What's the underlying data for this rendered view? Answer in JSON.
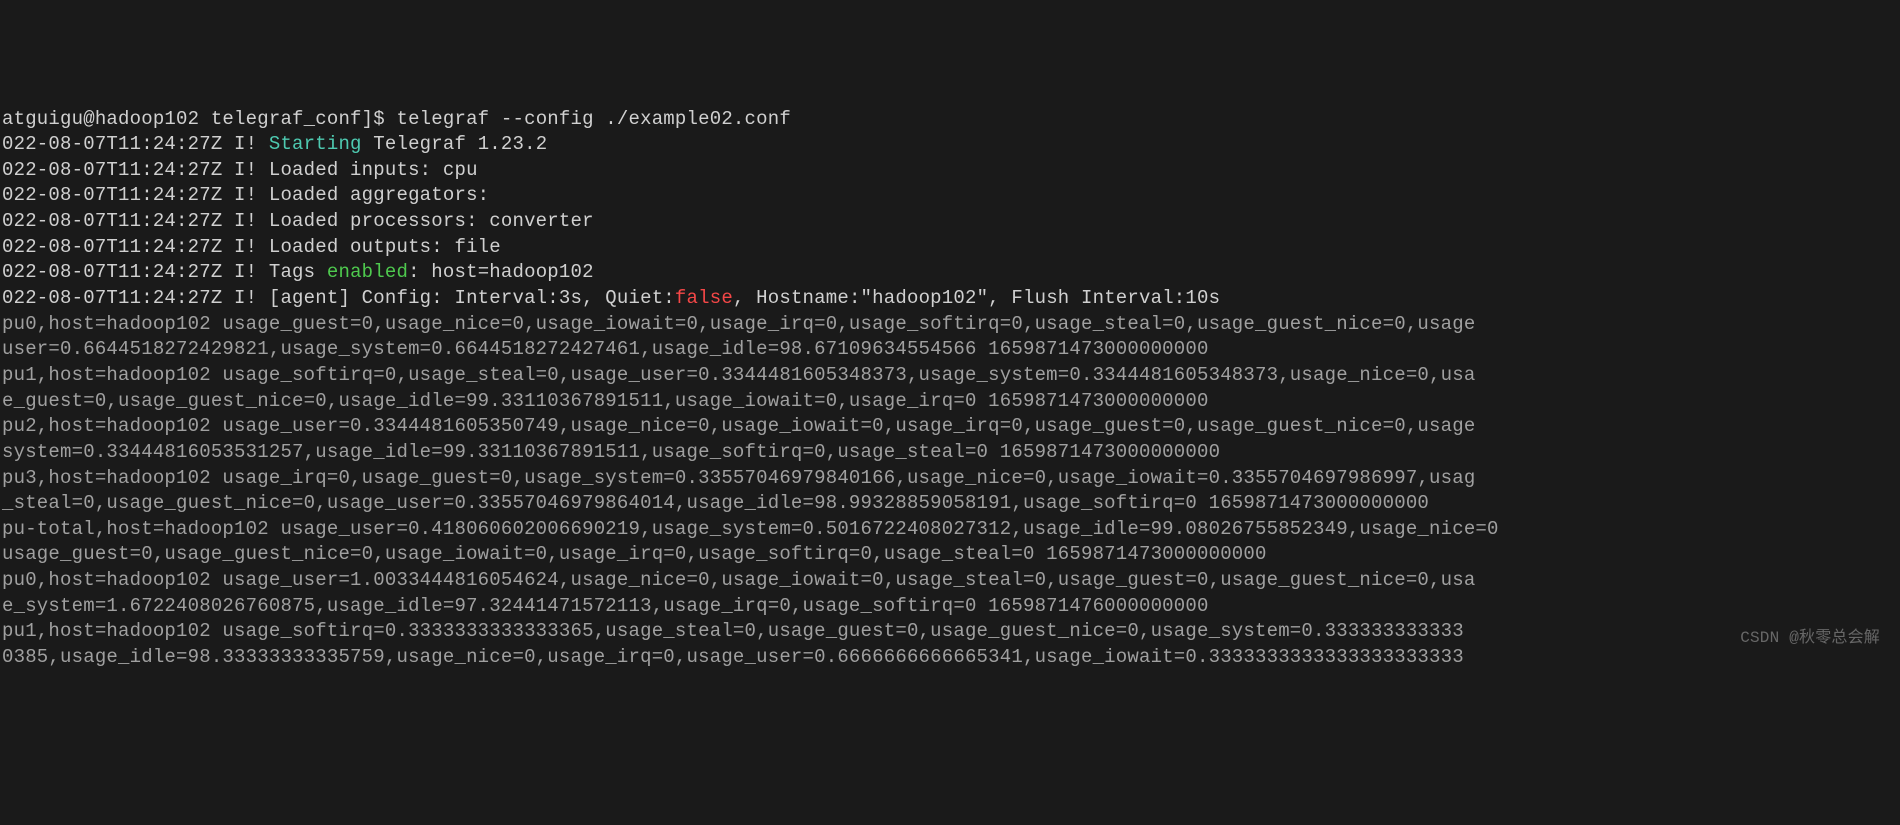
{
  "prompt": {
    "user": "atguigu@hadoop102 telegraf_conf]$ ",
    "command": "telegraf --config ./example02.conf"
  },
  "log_lines": [
    {
      "type": "startup",
      "ts": "022-08-07T11:24:27Z I! ",
      "cyan": "Starting",
      "rest": " Telegraf 1.23.2"
    },
    {
      "type": "plain",
      "text": "022-08-07T11:24:27Z I! Loaded inputs: cpu"
    },
    {
      "type": "plain",
      "text": "022-08-07T11:24:27Z I! Loaded aggregators:"
    },
    {
      "type": "plain",
      "text": "022-08-07T11:24:27Z I! Loaded processors: converter"
    },
    {
      "type": "plain",
      "text": "022-08-07T11:24:27Z I! Loaded outputs: file"
    },
    {
      "type": "tags",
      "ts": "022-08-07T11:24:27Z I! Tags ",
      "green": "enabled",
      "rest": ": host=hadoop102"
    },
    {
      "type": "agent",
      "ts": "022-08-07T11:24:27Z I! [agent] Config: Interval:3s, Quiet:",
      "red": "false",
      "rest": ", Hostname:\"hadoop102\", Flush Interval:10s"
    },
    {
      "type": "gray",
      "text": "pu0,host=hadoop102 usage_guest=0,usage_nice=0,usage_iowait=0,usage_irq=0,usage_softirq=0,usage_steal=0,usage_guest_nice=0,usage"
    },
    {
      "type": "gray",
      "text": "user=0.6644518272429821,usage_system=0.6644518272427461,usage_idle=98.67109634554566 1659871473000000000"
    },
    {
      "type": "gray",
      "text": "pu1,host=hadoop102 usage_softirq=0,usage_steal=0,usage_user=0.3344481605348373,usage_system=0.3344481605348373,usage_nice=0,usa"
    },
    {
      "type": "gray",
      "text": "e_guest=0,usage_guest_nice=0,usage_idle=99.33110367891511,usage_iowait=0,usage_irq=0 1659871473000000000"
    },
    {
      "type": "gray",
      "text": "pu2,host=hadoop102 usage_user=0.3344481605350749,usage_nice=0,usage_iowait=0,usage_irq=0,usage_guest=0,usage_guest_nice=0,usage"
    },
    {
      "type": "gray",
      "text": "system=0.33444816053531257,usage_idle=99.33110367891511,usage_softirq=0,usage_steal=0 1659871473000000000"
    },
    {
      "type": "gray",
      "text": "pu3,host=hadoop102 usage_irq=0,usage_guest=0,usage_system=0.33557046979840166,usage_nice=0,usage_iowait=0.3355704697986997,usag"
    },
    {
      "type": "gray",
      "text": "_steal=0,usage_guest_nice=0,usage_user=0.33557046979864014,usage_idle=98.99328859058191,usage_softirq=0 1659871473000000000"
    },
    {
      "type": "gray",
      "text": "pu-total,host=hadoop102 usage_user=0.418060602006690219,usage_system=0.5016722408027312,usage_idle=99.08026755852349,usage_nice=0"
    },
    {
      "type": "gray",
      "text": "usage_guest=0,usage_guest_nice=0,usage_iowait=0,usage_irq=0,usage_softirq=0,usage_steal=0 1659871473000000000"
    },
    {
      "type": "gray",
      "text": "pu0,host=hadoop102 usage_user=1.0033444816054624,usage_nice=0,usage_iowait=0,usage_steal=0,usage_guest=0,usage_guest_nice=0,usa"
    },
    {
      "type": "gray",
      "text": "e_system=1.6722408026760875,usage_idle=97.32441471572113,usage_irq=0,usage_softirq=0 1659871476000000000"
    },
    {
      "type": "gray",
      "text": "pu1,host=hadoop102 usage_softirq=0.3333333333333365,usage_steal=0,usage_guest=0,usage_guest_nice=0,usage_system=0.333333333333"
    },
    {
      "type": "gray",
      "text": "0385,usage_idle=98.33333333335759,usage_nice=0,usage_irq=0,usage_user=0.6666666666665341,usage_iowait=0.3333333333333333333333"
    }
  ],
  "watermark": "CSDN @秋零总会解"
}
